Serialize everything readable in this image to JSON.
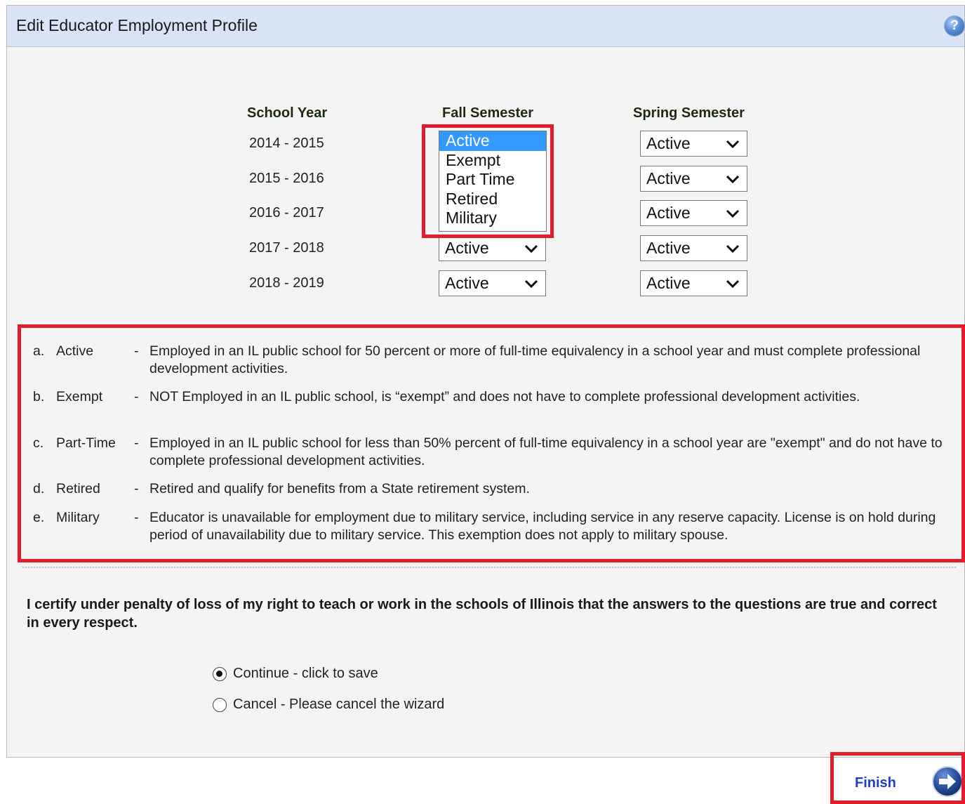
{
  "header": {
    "title": "Edit Educator Employment Profile",
    "help_icon": "?"
  },
  "columns": {
    "school_year": "School Year",
    "fall": "Fall Semester",
    "spring": "Spring Semester"
  },
  "rows": [
    {
      "year": "2014 - 2015",
      "fall": "Active",
      "spring": "Active"
    },
    {
      "year": "2015 - 2016",
      "fall": "",
      "spring": "Active"
    },
    {
      "year": "2016 - 2017",
      "fall": "",
      "spring": "Active"
    },
    {
      "year": "2017 - 2018",
      "fall": "Active",
      "spring": "Active"
    },
    {
      "year": "2018 - 2019",
      "fall": "Active",
      "spring": "Active"
    }
  ],
  "open_dropdown": {
    "options": [
      "Active",
      "Exempt",
      "Part Time",
      "Retired",
      "Military"
    ],
    "selected": "Active"
  },
  "legend": [
    {
      "letter": "a.",
      "term": "Active",
      "dash": "-",
      "desc": "Employed in an IL public school for 50 percent or more of full-time equivalency in a school year and must complete professional development activities."
    },
    {
      "letter": "b.",
      "term": "Exempt",
      "dash": "-",
      "desc": "NOT Employed in an IL public school, is “exempt” and does not have to complete professional development activities."
    },
    {
      "letter": "c.",
      "term": "Part-Time",
      "dash": "-",
      "desc": "Employed in an IL public school for less than 50% percent of full-time equivalency in a school year are \"exempt\" and do not have to complete professional development activities."
    },
    {
      "letter": "d.",
      "term": "Retired",
      "dash": "-",
      "desc": "Retired and qualify for benefits from a State retirement system."
    },
    {
      "letter": "e.",
      "term": "Military",
      "dash": "-",
      "desc": "Educator is unavailable for employment due to military service, including service in any reserve capacity. License is on hold during period of unavailability due to military service. This exemption does not apply to military spouse."
    }
  ],
  "certify_text": "I certify under penalty of loss of my right to teach or work in the schools of Illinois that the answers to the questions are true and correct in every respect.",
  "radios": [
    {
      "label": "Continue - click to save",
      "checked": true
    },
    {
      "label": "Cancel - Please cancel the wizard",
      "checked": false
    }
  ],
  "finish": {
    "label": "Finish",
    "icon": "arrow-right-circle-icon"
  },
  "colors": {
    "header_bg": "#d8e4f5",
    "highlight_red": "#e21c2a",
    "selected_option": "#3399ff",
    "finish_link": "#1e3fbf"
  }
}
